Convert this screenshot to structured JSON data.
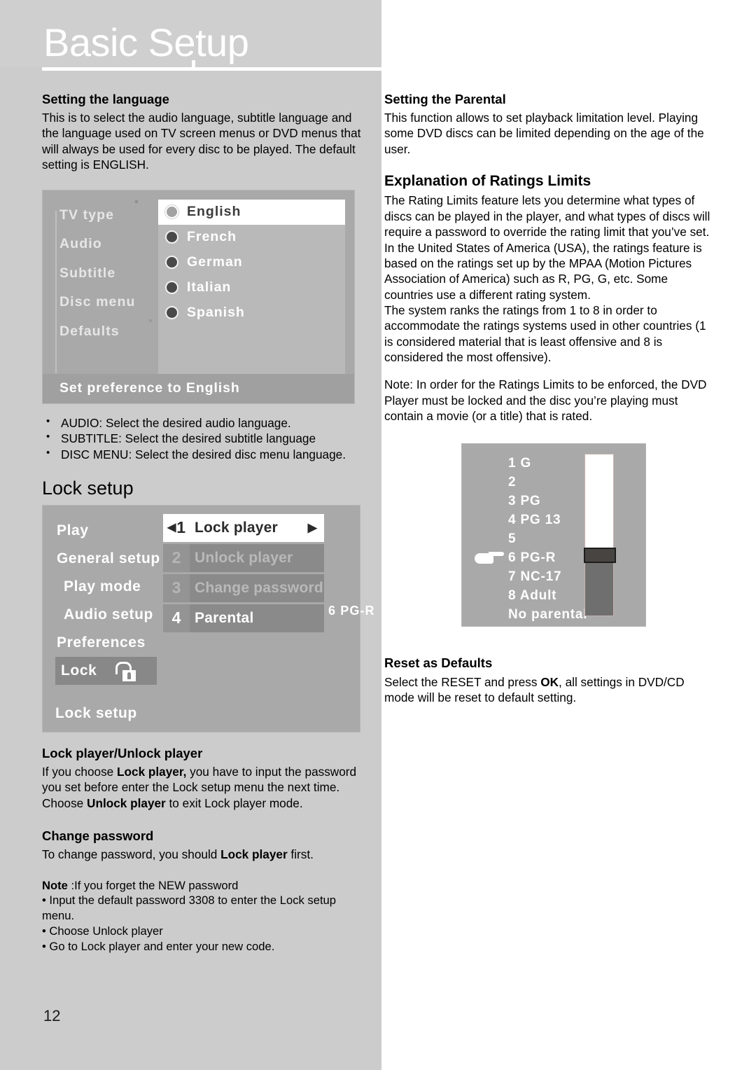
{
  "page": {
    "title": "Basic Setup",
    "number": "12"
  },
  "left_column": {
    "section_language": {
      "heading": "Setting the language",
      "paragraph": "This is to select the audio language, subtitle language and the language used on TV screen menus or DVD menus that will always be used for every disc to be played. The default setting is ENGLISH."
    },
    "language_screenshot": {
      "name": "language-preference-osd",
      "menu_items": [
        "TV type",
        "Audio",
        "Subtitle",
        "Disc menu",
        "Defaults"
      ],
      "options": [
        {
          "label": "English",
          "selected": true
        },
        {
          "label": "French",
          "selected": false
        },
        {
          "label": "German",
          "selected": false
        },
        {
          "label": "Italian",
          "selected": false
        },
        {
          "label": "Spanish",
          "selected": false
        }
      ],
      "status": "Set preference to English"
    },
    "bullets": [
      "AUDIO: Select the desired audio language.",
      "SUBTITLE: Select the desired subtitle language",
      "DISC MENU: Select the desired disc menu language."
    ],
    "lock_setup_heading": "Lock setup",
    "lock_screenshot": {
      "name": "lock-setup-osd",
      "menu_items": [
        "Play",
        "General setup",
        "Play mode",
        "Audio setup",
        "Preferences",
        "Lock"
      ],
      "submenu": [
        {
          "num": "1",
          "label": "Lock player",
          "state": "highlighted"
        },
        {
          "num": "2",
          "label": "Unlock player",
          "state": "dimmed"
        },
        {
          "num": "3",
          "label": "Change password",
          "state": "dimmed"
        },
        {
          "num": "4",
          "label": "Parental",
          "state": "normal"
        }
      ],
      "parental_value": "6 PG-R",
      "status": "Lock setup"
    },
    "section_lock_player": {
      "heading": "Lock player/Unlock player",
      "body_1": "If you choose ",
      "bold_1": "Lock player,",
      "body_2": " you have to input the password you set before enter the Lock setup menu the next time. Choose ",
      "bold_2": "Unlock player",
      "body_3": " to exit Lock player mode."
    },
    "section_change_password": {
      "heading": "Change password",
      "body_1": "To change password, you should ",
      "bold_1": "Lock player",
      "body_2": " first."
    },
    "note": {
      "bold": "Note",
      "title_rest": " :If you forget the NEW password",
      "items": [
        "Input the default password 3308  to enter the Lock setup menu.",
        "Choose Unlock player",
        "Go to Lock player    and enter your new code."
      ]
    }
  },
  "right_column": {
    "section_parental": {
      "heading": "Setting the Parental",
      "paragraph": "This function allows to set playback limitation level. Playing some DVD discs can be limited depending on the age of the user."
    },
    "section_ratings": {
      "heading": "Explanation of Ratings Limits",
      "paragraph_1": "The Rating Limits feature lets you determine what types of discs can be played in the player, and what types of discs will require a password to override the rating limit that you’ve set. In the United States of America (USA), the ratings feature is based on the ratings set up by the MPAA (Motion Pictures Association of America) such as R, PG, G, etc. Some countries use a different rating system.",
      "paragraph_2": "The system ranks the ratings from 1 to 8 in order to accommodate the ratings systems used in other countries (1 is considered material that is least offensive and 8 is considered the most offensive).",
      "paragraph_3": "Note: In order for the Ratings Limits to be enforced, the DVD Player must be locked and the disc you’re playing must contain a movie (or a title) that is rated."
    },
    "ratings_screenshot": {
      "name": "parental-ratings-osd",
      "rows": [
        "1 G",
        "2",
        "3 PG",
        "4 PG 13",
        "5",
        "6 PG-R",
        "7 NC-17",
        "8 Adult",
        "No parental"
      ],
      "pointer_row_index": 5
    },
    "section_reset": {
      "heading": "Reset as Defaults",
      "body_1": "Select the RESET and press ",
      "bold_1": "OK",
      "body_2": ",  all settings in DVD/CD mode will be reset to default setting."
    }
  },
  "colors": {
    "band_gray": "#cccccc",
    "osd_gray": "#a9a9a9",
    "osd_panel": "#b9b9b9",
    "osd_row": "#8a8a8a",
    "highlight_white": "#ffffff"
  }
}
